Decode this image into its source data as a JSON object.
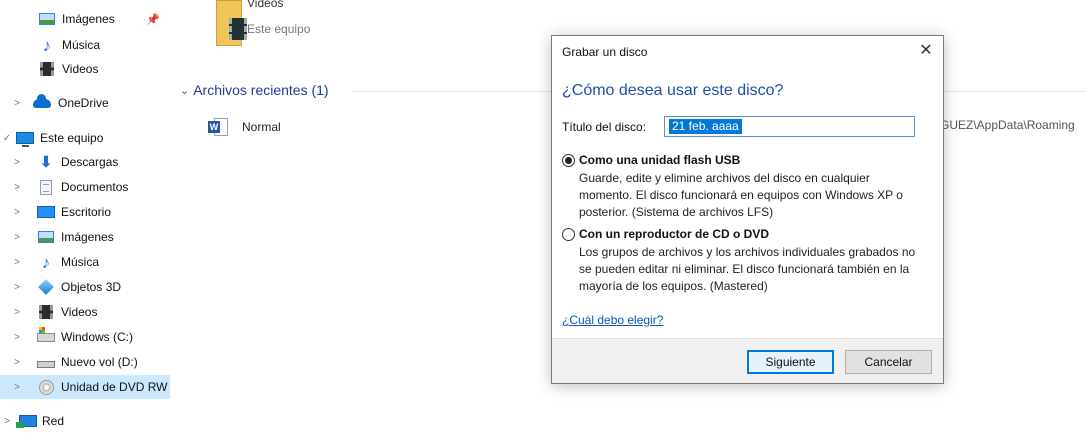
{
  "sidebar": {
    "items": [
      {
        "label": "Imágenes",
        "icon": "pictures-icon",
        "pinned": true,
        "pin_glyph": "📌"
      },
      {
        "label": "Música",
        "icon": "music-icon"
      },
      {
        "label": "Videos",
        "icon": "videos-icon"
      },
      {
        "label": "OneDrive",
        "icon": "onedrive-icon",
        "chevron": ">"
      },
      {
        "label": "Este equipo",
        "icon": "this-pc-icon",
        "chevron": "✓"
      },
      {
        "label": "Descargas",
        "icon": "downloads-icon",
        "chevron": ">"
      },
      {
        "label": "Documentos",
        "icon": "documents-icon",
        "chevron": ">"
      },
      {
        "label": "Escritorio",
        "icon": "desktop-icon",
        "chevron": ">"
      },
      {
        "label": "Imágenes",
        "icon": "pictures-icon",
        "chevron": ">"
      },
      {
        "label": "Música",
        "icon": "music-icon",
        "chevron": ">"
      },
      {
        "label": "Objetos 3D",
        "icon": "3d-objects-icon",
        "chevron": ">"
      },
      {
        "label": "Videos",
        "icon": "videos-icon",
        "chevron": ">"
      },
      {
        "label": "Windows  (C:)",
        "icon": "windows-drive-icon",
        "chevron": ">"
      },
      {
        "label": "Nuevo vol (D:)",
        "icon": "drive-icon",
        "chevron": ">"
      },
      {
        "label": "Unidad de DVD RW",
        "icon": "dvd-drive-icon",
        "chevron": ">",
        "selected": true
      },
      {
        "label": "Red",
        "icon": "network-icon",
        "chevron": ">"
      }
    ]
  },
  "main": {
    "top_folder": {
      "name": "Videos",
      "location": "Este equipo"
    },
    "recent_group": {
      "chevron": "⌄",
      "title": "Archivos recientes (1)"
    },
    "recent_item": {
      "name": "Normal",
      "word_letter": "W",
      "path_fragment": "GUEZ\\AppData\\Roaming"
    }
  },
  "dialog": {
    "title": "Grabar un disco",
    "close_glyph": "✕",
    "question": "¿Cómo desea usar este disco?",
    "disc_title_label": "Título del disco:",
    "disc_title_value": "21 feb. aaaa",
    "options": [
      {
        "title": "Como una unidad flash USB",
        "checked": true,
        "lines": [
          "Guarde, edite y elimine archivos del disco en cualquier",
          "momento. El disco funcionará en equipos con Windows XP o",
          "posterior. (Sistema de archivos LFS)"
        ]
      },
      {
        "title": "Con un reproductor de CD o DVD",
        "checked": false,
        "lines": [
          "Los grupos de archivos y los archivos individuales grabados no",
          "se pueden editar ni eliminar. El disco funcionará también en la",
          "mayoría de los equipos. (Mastered)"
        ]
      }
    ],
    "help_link": "¿Cuál debo elegir?",
    "next_button": "Siguiente",
    "cancel_button": "Cancelar",
    "accent_color": "#0078d7",
    "heading_color": "#1f4fa8"
  }
}
